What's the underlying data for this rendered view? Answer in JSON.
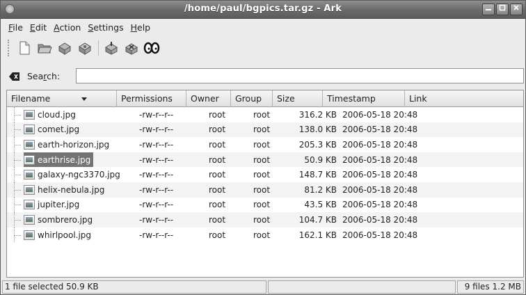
{
  "window": {
    "title": "/home/paul/bgpics.tar.gz - Ark",
    "buttons": [
      "minimize-button",
      "maximize-button",
      "close-button"
    ]
  },
  "menubar": {
    "items": [
      {
        "u": "F",
        "rest": "ile"
      },
      {
        "u": "E",
        "rest": "dit"
      },
      {
        "u": "A",
        "rest": "ction"
      },
      {
        "u": "S",
        "rest": "ettings"
      },
      {
        "u": "H",
        "rest": "elp"
      }
    ]
  },
  "toolbar": {
    "icons": [
      "new-archive-icon",
      "open-archive-icon",
      "add-files-icon",
      "add-folder-icon",
      "extract-icon",
      "delete-icon",
      "view-icon"
    ]
  },
  "search": {
    "label_pre": "Sea",
    "label_u": "r",
    "label_post": "ch:",
    "value": "",
    "placeholder": ""
  },
  "table": {
    "columns": [
      "Filename",
      "Permissions",
      "Owner",
      "Group",
      "Size",
      "Timestamp",
      "Link"
    ],
    "sort_column": "Filename",
    "rows": [
      {
        "name": "cloud.jpg",
        "perm": "-rw-r--r--",
        "owner": "root",
        "group": "root",
        "size": "316.2 KB",
        "ts": "2006-05-18 20:48",
        "link": ""
      },
      {
        "name": "comet.jpg",
        "perm": "-rw-r--r--",
        "owner": "root",
        "group": "root",
        "size": "138.0 KB",
        "ts": "2006-05-18 20:48",
        "link": ""
      },
      {
        "name": "earth-horizon.jpg",
        "perm": "-rw-r--r--",
        "owner": "root",
        "group": "root",
        "size": "205.3 KB",
        "ts": "2006-05-18 20:48",
        "link": ""
      },
      {
        "name": "earthrise.jpg",
        "perm": "-rw-r--r--",
        "owner": "root",
        "group": "root",
        "size": "50.9 KB",
        "ts": "2006-05-18 20:48",
        "link": "",
        "selected": true
      },
      {
        "name": "galaxy-ngc3370.jpg",
        "perm": "-rw-r--r--",
        "owner": "root",
        "group": "root",
        "size": "148.7 KB",
        "ts": "2006-05-18 20:48",
        "link": ""
      },
      {
        "name": "helix-nebula.jpg",
        "perm": "-rw-r--r--",
        "owner": "root",
        "group": "root",
        "size": "81.2 KB",
        "ts": "2006-05-18 20:48",
        "link": ""
      },
      {
        "name": "jupiter.jpg",
        "perm": "-rw-r--r--",
        "owner": "root",
        "group": "root",
        "size": "43.5 KB",
        "ts": "2006-05-18 20:48",
        "link": ""
      },
      {
        "name": "sombrero.jpg",
        "perm": "-rw-r--r--",
        "owner": "root",
        "group": "root",
        "size": "104.7 KB",
        "ts": "2006-05-18 20:48",
        "link": ""
      },
      {
        "name": "whirlpool.jpg",
        "perm": "-rw-r--r--",
        "owner": "root",
        "group": "root",
        "size": "162.1 KB",
        "ts": "2006-05-18 20:48",
        "link": ""
      }
    ]
  },
  "status": {
    "selection": "1 file selected  50.9 KB",
    "middle": "",
    "totals": "9 files  1.2 MB"
  }
}
